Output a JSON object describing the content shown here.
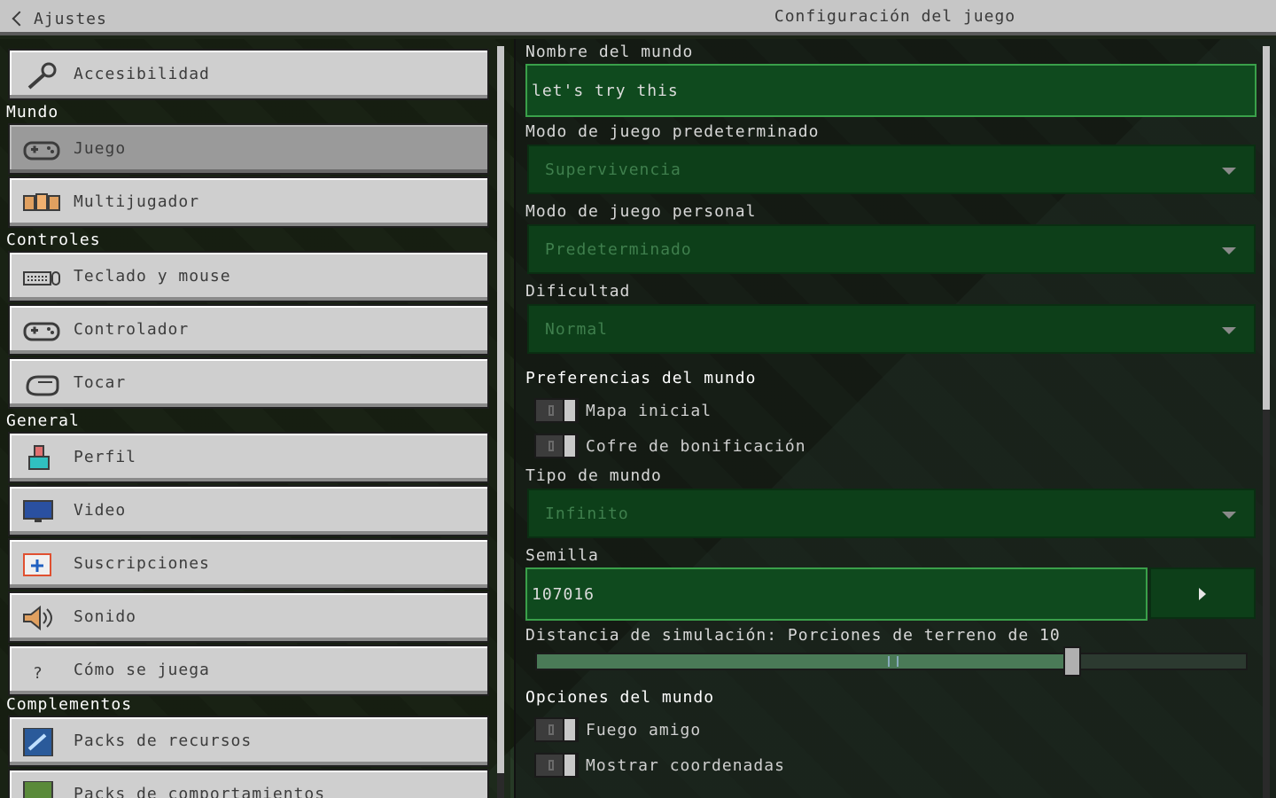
{
  "header": {
    "back_label": "Ajustes",
    "title": "Configuración del juego"
  },
  "sidebar": {
    "top_items": [
      {
        "label": "Accesibilidad",
        "icon": "key-icon"
      }
    ],
    "sections": [
      {
        "title": "Mundo"
      },
      {
        "title": "Controles"
      },
      {
        "title": "General"
      },
      {
        "title": "Complementos"
      }
    ],
    "items": [
      {
        "label": "Accesibilidad"
      },
      {
        "label": "Juego"
      },
      {
        "label": "Multijugador"
      },
      {
        "label": "Teclado y mouse"
      },
      {
        "label": "Controlador"
      },
      {
        "label": "Tocar"
      },
      {
        "label": "Perfil"
      },
      {
        "label": "Video"
      },
      {
        "label": "Suscripciones"
      },
      {
        "label": "Sonido"
      },
      {
        "label": "Cómo se juega"
      },
      {
        "label": "Packs de recursos"
      },
      {
        "label": "Packs de comportamientos"
      }
    ],
    "selected": "Juego"
  },
  "settings": {
    "world_name_label": "Nombre del mundo",
    "world_name_value": "let's try this",
    "default_mode_label": "Modo de juego predeterminado",
    "default_mode_value": "Supervivencia",
    "personal_mode_label": "Modo de juego personal",
    "personal_mode_value": "Predeterminado",
    "difficulty_label": "Dificultad",
    "difficulty_value": "Normal",
    "world_prefs_title": "Preferencias del mundo",
    "starter_map_label": "Mapa inicial",
    "bonus_chest_label": "Cofre de bonificación",
    "world_type_label": "Tipo de mundo",
    "world_type_value": "Infinito",
    "seed_label": "Semilla",
    "seed_value": "107016",
    "sim_distance_label": "Distancia de simulación: Porciones de terreno de 10",
    "sim_distance_value": 10,
    "world_options_title": "Opciones del mundo",
    "friendly_fire_label": "Fuego amigo",
    "show_coords_label": "Mostrar coordenadas"
  },
  "colors": {
    "accent_green": "#0f4a1e",
    "button_gray": "#cfcfcf",
    "selected_gray": "#9a9a9a"
  }
}
